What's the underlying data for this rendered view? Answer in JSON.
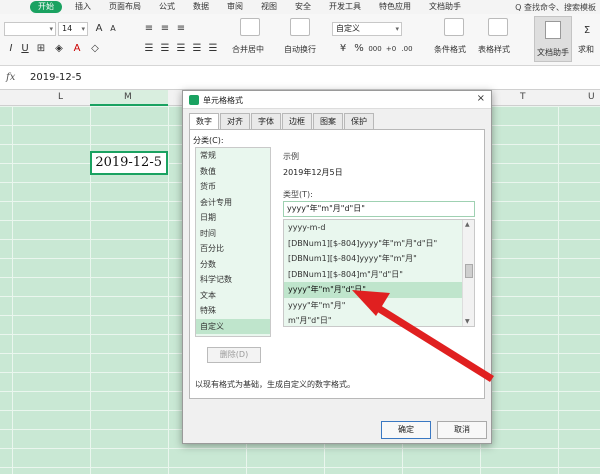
{
  "ribbon": {
    "tabs": [
      "开始",
      "插入",
      "页面布局",
      "公式",
      "数据",
      "审阅",
      "视图",
      "安全",
      "开发工具",
      "特色应用",
      "文档助手"
    ],
    "active_tab": "开始",
    "right_text": "Q 查找命令、搜索模板",
    "font_size": "14",
    "number_format": "自定义",
    "merge_label": "合并居中",
    "wrap_label": "自动换行",
    "cond_format_label": "条件格式",
    "table_style_label": "表格样式",
    "doc_helper_label": "文档助手",
    "sum_label": "求和"
  },
  "formula_bar": {
    "fx": "fx",
    "value": "2019-12-5"
  },
  "sheet": {
    "columns": [
      "L",
      "M",
      "T",
      "U"
    ],
    "active_cell_value": "2019-12-5"
  },
  "dialog": {
    "title": "单元格格式",
    "close": "×",
    "tabs": [
      "数字",
      "对齐",
      "字体",
      "边框",
      "图案",
      "保护"
    ],
    "active_tab": "数字",
    "category_label": "分类(C):",
    "categories": [
      "常规",
      "数值",
      "货币",
      "会计专用",
      "日期",
      "时间",
      "百分比",
      "分数",
      "科学记数",
      "文本",
      "特殊",
      "自定义"
    ],
    "selected_category": "自定义",
    "delete_button": "删除(D)",
    "sample_label": "示例",
    "sample_value": "2019年12月5日",
    "type_label": "类型(T):",
    "type_value": "yyyy\"年\"m\"月\"d\"日\"",
    "type_list": [
      "yyyy-m-d",
      "[DBNum1][$-804]yyyy\"年\"m\"月\"d\"日\"",
      "[DBNum1][$-804]yyyy\"年\"m\"月\"",
      "[DBNum1][$-804]m\"月\"d\"日\"",
      "yyyy\"年\"m\"月\"d\"日\"",
      "yyyy\"年\"m\"月\"",
      "m\"月\"d\"日\""
    ],
    "selected_type_index": 4,
    "description": "以现有格式为基础，生成自定义的数字格式。",
    "ok_button": "确定",
    "cancel_button": "取消"
  },
  "colors": {
    "accent": "#1aa261",
    "arrow": "#e02020"
  },
  "icons": [
    "close-icon",
    "scroll-up-icon",
    "scroll-down-icon",
    "fx-icon",
    "dialog-app-icon"
  ]
}
